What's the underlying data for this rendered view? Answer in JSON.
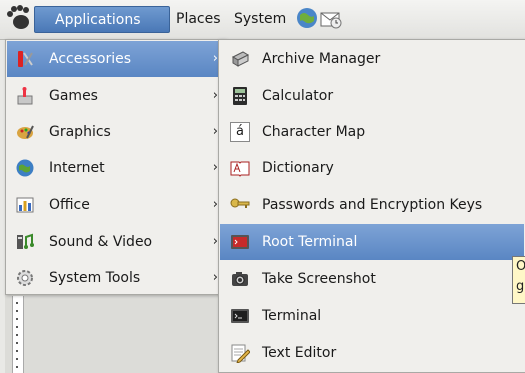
{
  "panel": {
    "applications_label": "Applications",
    "places_label": "Places",
    "system_label": "System"
  },
  "main_menu": {
    "items": [
      {
        "label": "Accessories",
        "icon": "accessories-icon",
        "active": true
      },
      {
        "label": "Games",
        "icon": "games-icon"
      },
      {
        "label": "Graphics",
        "icon": "graphics-icon"
      },
      {
        "label": "Internet",
        "icon": "internet-icon"
      },
      {
        "label": "Office",
        "icon": "office-icon"
      },
      {
        "label": "Sound & Video",
        "icon": "sound-video-icon"
      },
      {
        "label": "System Tools",
        "icon": "system-tools-icon"
      }
    ],
    "arrow": "›"
  },
  "sub_menu": {
    "items": [
      {
        "label": "Archive Manager",
        "icon": "archive-manager-icon"
      },
      {
        "label": "Calculator",
        "icon": "calculator-icon"
      },
      {
        "label": "Character Map",
        "icon": "character-map-icon"
      },
      {
        "label": "Dictionary",
        "icon": "dictionary-icon"
      },
      {
        "label": "Passwords and Encryption Keys",
        "icon": "keys-icon"
      },
      {
        "label": "Root Terminal",
        "icon": "root-terminal-icon",
        "active": true
      },
      {
        "label": "Take Screenshot",
        "icon": "camera-icon"
      },
      {
        "label": "Terminal",
        "icon": "terminal-icon"
      },
      {
        "label": "Text Editor",
        "icon": "text-editor-icon"
      }
    ]
  },
  "tooltip": {
    "line1": "O",
    "line2": "g"
  },
  "character_map_glyph": "á",
  "colors": {
    "accent": "#5a86c3",
    "menu_bg": "#f0efec",
    "tooltip_bg": "#fff7c7"
  }
}
